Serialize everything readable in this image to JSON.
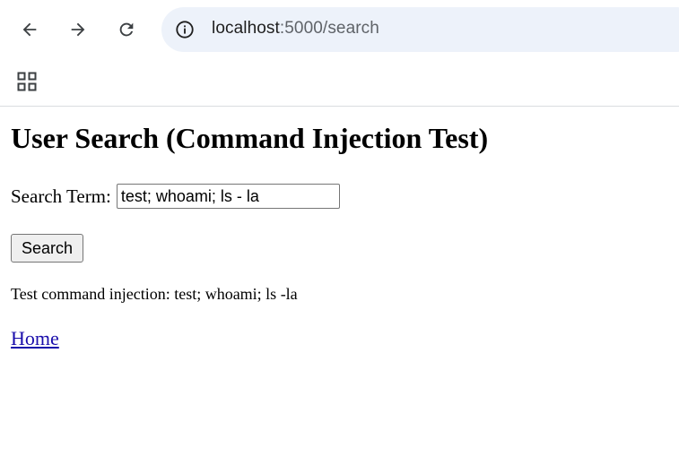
{
  "browser": {
    "url_host": "localhost",
    "url_path": ":5000/search",
    "icons": [
      "back-arrow-icon",
      "forward-arrow-icon",
      "reload-icon",
      "site-info-icon",
      "apps-grid-icon"
    ]
  },
  "page": {
    "title": "User Search (Command Injection Test)",
    "search_label": "Search Term:",
    "search_value": "test; whoami; ls - la",
    "search_button": "Search",
    "result_text": "Test command injection: test; whoami; ls -la",
    "home_link": "Home"
  },
  "colors": {
    "omnibox_bg": "#edf2fa",
    "link": "#1a0dab"
  }
}
